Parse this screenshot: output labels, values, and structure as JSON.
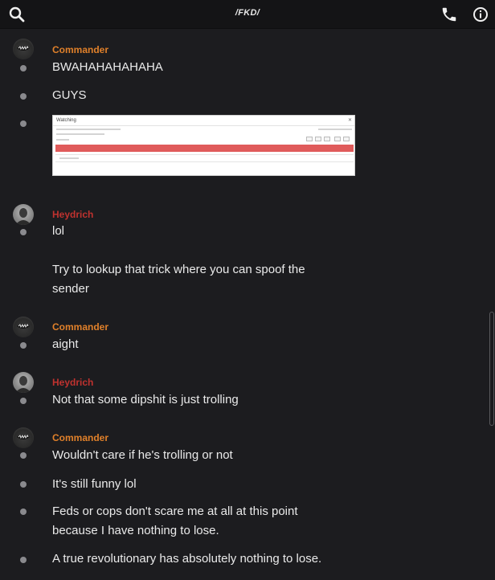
{
  "header": {
    "channel_title": "/FKD/",
    "search_icon": "search-icon",
    "call_icon": "phone-icon",
    "info_icon": "info-icon"
  },
  "users": {
    "commander": {
      "name": "Commander",
      "color": "#e0802a"
    },
    "heydrich": {
      "name": "Heydrich",
      "color": "#c0322f"
    }
  },
  "messages": {
    "m1": "BWAHAHAHAHAHA",
    "m2": "GUYS",
    "m3_image": {
      "title": "Watching",
      "kind": "screenshot-attachment"
    },
    "m4": "lol",
    "m5": "Try to lookup that trick where you can spoof the sender",
    "m6": "aight",
    "m7": "Not that some dipshit is just trolling",
    "m8": "Wouldn't care if he's trolling or not",
    "m9": "It's still funny lol",
    "m10": "Feds or cops don't scare me at all at this point because I have nothing to lose.",
    "m11": "A true revolutionary has absolutely nothing to lose."
  }
}
